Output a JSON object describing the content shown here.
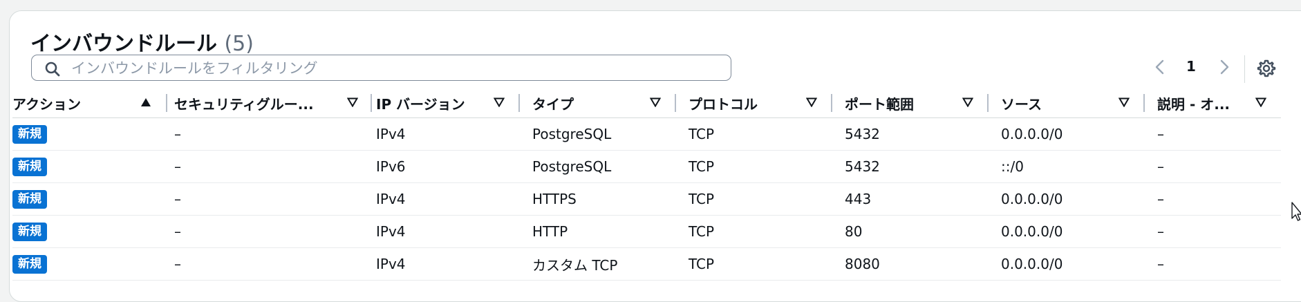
{
  "panel": {
    "title": "インバウンドルール",
    "count": "(5)"
  },
  "search": {
    "placeholder": "インバウンドルールをフィルタリング",
    "icon": "search-icon"
  },
  "pagination": {
    "current_page": "1",
    "prev_icon": "chevron-left-icon",
    "next_icon": "chevron-right-icon"
  },
  "settings_icon": "gear-icon",
  "table": {
    "columns": [
      {
        "label": "アクション",
        "sort": "ascending"
      },
      {
        "label": "セキュリティグルー...",
        "sort": "none"
      },
      {
        "label": "IP バージョン",
        "sort": "none"
      },
      {
        "label": "タイプ",
        "sort": "none"
      },
      {
        "label": "プロトコル",
        "sort": "none"
      },
      {
        "label": "ポート範囲",
        "sort": "none"
      },
      {
        "label": "ソース",
        "sort": "none"
      },
      {
        "label": "説明 - オ...",
        "sort": "none"
      }
    ],
    "rows": [
      {
        "action": "新規",
        "security_group": "–",
        "ip_version": "IPv4",
        "type": "PostgreSQL",
        "protocol": "TCP",
        "port_range": "5432",
        "source": "0.0.0.0/0",
        "description": "–"
      },
      {
        "action": "新規",
        "security_group": "–",
        "ip_version": "IPv6",
        "type": "PostgreSQL",
        "protocol": "TCP",
        "port_range": "5432",
        "source": "::/0",
        "description": "–"
      },
      {
        "action": "新規",
        "security_group": "–",
        "ip_version": "IPv4",
        "type": "HTTPS",
        "protocol": "TCP",
        "port_range": "443",
        "source": "0.0.0.0/0",
        "description": "–"
      },
      {
        "action": "新規",
        "security_group": "–",
        "ip_version": "IPv4",
        "type": "HTTP",
        "protocol": "TCP",
        "port_range": "80",
        "source": "0.0.0.0/0",
        "description": "–"
      },
      {
        "action": "新規",
        "security_group": "–",
        "ip_version": "IPv4",
        "type": "カスタム TCP",
        "protocol": "TCP",
        "port_range": "8080",
        "source": "0.0.0.0/0",
        "description": "–"
      }
    ]
  },
  "colors": {
    "badge": "#0972d3",
    "text": "#0f141a",
    "muted": "#5f6b7a"
  }
}
